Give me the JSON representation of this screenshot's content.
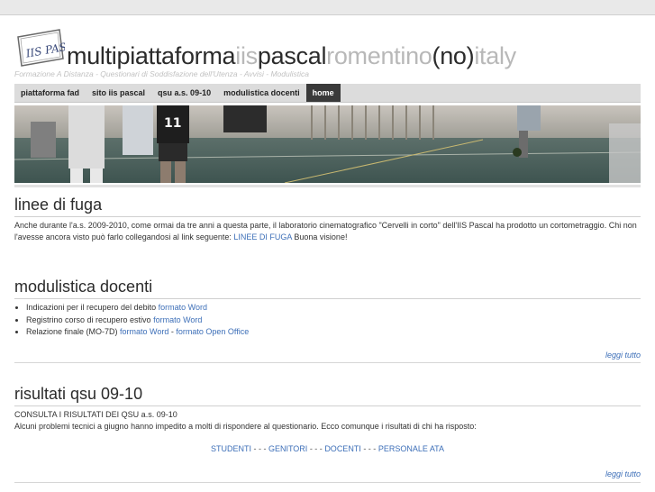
{
  "header": {
    "title_parts": [
      "multipiattaforma",
      "iis",
      "pascal",
      "romentino",
      "(no)",
      "italy"
    ],
    "tagline": "Formazione A Distanza - Questionari di Soddisfazione dell'Utenza - Avvisi - Modulistica",
    "logo_text": "IIS PASCAL"
  },
  "nav": {
    "items": [
      "piattaforma fad",
      "sito iis pascal",
      "qsu a.s. 09-10",
      "modulistica docenti",
      "home"
    ],
    "active": "home"
  },
  "sections": {
    "linee": {
      "title": "linee di fuga",
      "body_before": "Anche durante l'a.s. 2009-2010, come ormai da tre anni a questa parte, il laboratorio cinematografico \"Cervelli in corto\" dell'IIS Pascal ha prodotto un cortometraggio. Chi non l'avesse ancora visto può farlo collegandosi al link seguente: ",
      "link": "LINEE DI FUGA",
      "body_after": " Buona visione!"
    },
    "modulistica": {
      "title": "modulistica docenti",
      "items": [
        {
          "text": "Indicazioni per il recupero del debito ",
          "link1": "formato Word"
        },
        {
          "text": "Registrino corso di recupero estivo ",
          "link1": "formato Word"
        },
        {
          "text": "Relazione finale (MO-7D) ",
          "link1": "formato Word",
          "sep": " - ",
          "link2": "formato Open Office"
        }
      ],
      "readmore": "leggi tutto"
    },
    "risultati": {
      "title": "risultati qsu 09-10",
      "line1": "CONSULTA I RISULTATI DEI QSU a.s. 09-10",
      "line2": "Alcuni problemi tecnici a giugno hanno impedito a molti di rispondere al questionario. Ecco comunque i risultati di chi ha risposto:",
      "links": [
        "STUDENTI",
        "GENITORI",
        "DOCENTI",
        "PERSONALE ATA"
      ],
      "link_sep": " - - - ",
      "readmore": "leggi tutto"
    }
  },
  "colors": {
    "link": "#3d6fb8",
    "nav_active_bg": "#3a3a3a",
    "title_light": "#b8b8b8"
  }
}
